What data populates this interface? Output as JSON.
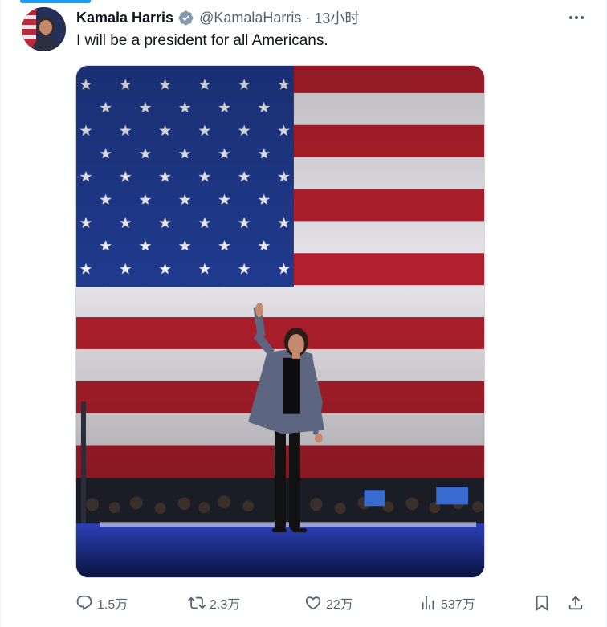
{
  "tweet": {
    "author_name": "Kamala Harris",
    "handle": "@KamalaHarris",
    "separator": "·",
    "timestamp": "13小时",
    "text": "I will be a president for all Americans.",
    "verified": true,
    "verified_color": "#829aab"
  },
  "media": {
    "description_hidden": true
  },
  "actions": {
    "replies": "1.5万",
    "retweets": "2.3万",
    "likes": "22万",
    "views": "537万"
  },
  "icons": {
    "more": "more-icon",
    "reply": "reply-icon",
    "retweet": "retweet-icon",
    "like": "heart-icon",
    "views": "views-icon",
    "bookmark": "bookmark-icon",
    "share": "share-icon"
  },
  "colors": {
    "accent": "#1d9bf0",
    "text_secondary": "#536471",
    "flag_red": "#b3202d",
    "flag_blue": "#1f3a8c"
  }
}
